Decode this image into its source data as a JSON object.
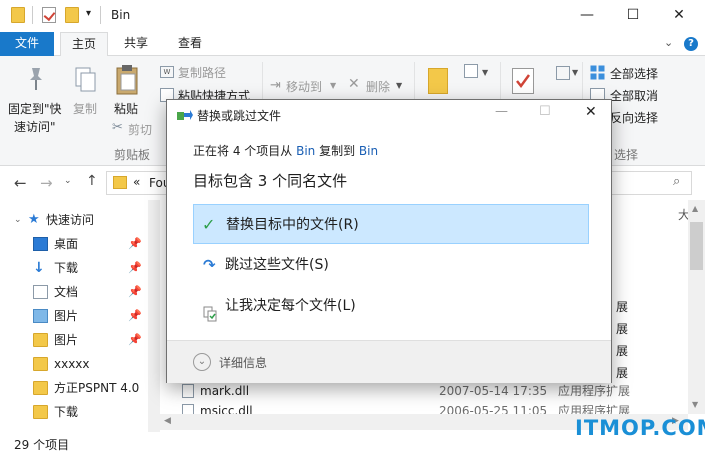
{
  "window": {
    "title": "Bin",
    "minimize_glyph": "—",
    "maximize_glyph": "☐",
    "close_glyph": "✕"
  },
  "tabs": [
    {
      "label": "文件",
      "active": false,
      "accent": "#1979ca"
    },
    {
      "label": "主页",
      "active": true
    },
    {
      "label": "共享",
      "active": false
    },
    {
      "label": "查看",
      "active": false
    }
  ],
  "ribbon": {
    "pin_quick_access": "固定到\"快速访问\"",
    "pin_line1": "固定到\"快",
    "pin_line2": "速访问\"",
    "copy": "复制",
    "paste": "粘贴",
    "copy_path": "复制路径",
    "paste_shortcut": "粘贴快捷方式",
    "cut": "剪切",
    "clipboard_group": "剪贴板",
    "move_to": "移动到",
    "delete": "删除",
    "select_all": "全部选择",
    "select_none": "全部取消",
    "invert_selection": "反向选择",
    "select_group": "选择",
    "invert_partial": "反向选择"
  },
  "address": {
    "path_prefix": "«",
    "path_text": "Fou"
  },
  "nav": {
    "items": [
      {
        "label": "快速访问",
        "icon": "star-icon",
        "pinned": false
      },
      {
        "label": "桌面",
        "icon": "desktop-icon",
        "pinned": true
      },
      {
        "label": "下载",
        "icon": "download-icon",
        "pinned": true
      },
      {
        "label": "文档",
        "icon": "document-icon",
        "pinned": true
      },
      {
        "label": "图片",
        "icon": "pictures-icon",
        "pinned": true
      },
      {
        "label": "图片",
        "icon": "folder-icon",
        "pinned": true
      },
      {
        "label": "xxxxx",
        "icon": "folder-icon",
        "pinned": false
      },
      {
        "label": "方正PSPNT 4.0",
        "icon": "folder-icon",
        "pinned": false
      },
      {
        "label": "下载",
        "icon": "folder-icon",
        "pinned": false
      }
    ]
  },
  "files": {
    "partial_type_labels": [
      "展",
      "展",
      "展",
      "展"
    ],
    "rows": [
      {
        "name": "mark.dll",
        "date": "2007-05-14 17:35",
        "type": "应用程序扩展"
      },
      {
        "name": "msicc.dll",
        "date": "2006-05-25 11:05",
        "type": "应用程序扩展"
      }
    ],
    "header_partial": "大"
  },
  "status": {
    "count": "29 个项目"
  },
  "dialog": {
    "title": "替换或跳过文件",
    "progress_prefix": "正在将 4 个项目从 ",
    "source": "Bin",
    "progress_mid": " 复制到 ",
    "dest": "Bin",
    "heading": "目标包含 3 个同名文件",
    "option_replace": "替换目标中的文件(R)",
    "option_skip": "跳过这些文件(S)",
    "option_decide": "让我决定每个文件(L)",
    "details": "详细信息",
    "highlight_color": "#cce8ff"
  },
  "watermark": {
    "text": "ITMOP.COM"
  }
}
